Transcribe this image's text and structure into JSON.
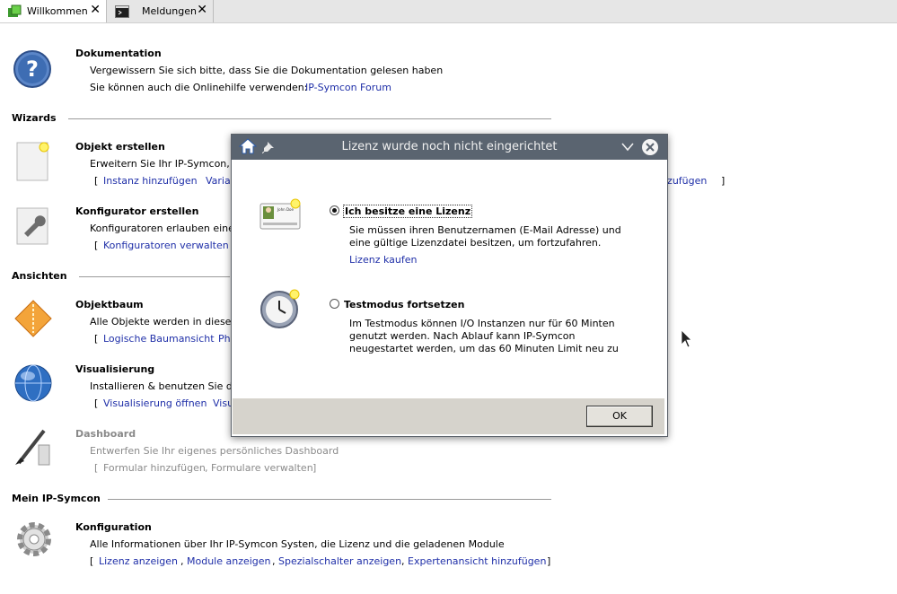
{
  "tabs": [
    {
      "label": "Willkommen",
      "active": true
    },
    {
      "label": "Meldungen",
      "active": false
    }
  ],
  "doc": {
    "title": "Dokumentation",
    "line1": "Vergewissern Sie sich bitte, dass Sie die Dokumentation gelesen haben",
    "line2": "Sie können auch die Onlinehilfe verwenden:",
    "forum_link": "IP-Symcon Forum"
  },
  "sections": {
    "wizards": "Wizards",
    "ansichten": "Ansichten",
    "mein": "Mein IP-Symcon"
  },
  "objekt": {
    "title": "Objekt erstellen",
    "desc": "Erweitern Sie Ihr IP-Symcon, ind",
    "link1": "Instanz hinzufügen",
    "link2": "Variab",
    "link_end": "ızufügen"
  },
  "konfigurator": {
    "title": "Konfigurator erstellen",
    "desc": "Konfiguratoren erlauben eine ein",
    "link1": "Konfiguratoren verwalten"
  },
  "objektbaum": {
    "title": "Objektbaum",
    "desc": "Alle Objekte werden in diesem Ba",
    "link1": "Logische Baumansicht",
    "link2": "Phy"
  },
  "visual": {
    "title": "Visualisierung",
    "desc": "Installieren & benutzen Sie das I",
    "link1": "Visualisierung öffnen",
    "link2": "Visu"
  },
  "dashboard": {
    "title": "Dashboard",
    "desc": "Entwerfen Sie Ihr eigenes persönliches Dashboard",
    "link1": "Formular hinzufügen",
    "link2": "Formulare verwalten"
  },
  "konfig": {
    "title": "Konfiguration",
    "desc": "Alle Informationen über Ihr IP-Symcon Systen, die Lizenz und die geladenen Module",
    "link1": "Lizenz anzeigen",
    "link2": "Module anzeigen",
    "link3": "Spezialschalter anzeigen",
    "link4": "Expertenansicht hinzufügen"
  },
  "brackets": {
    "open": "[",
    "close": "]",
    "sep": ","
  },
  "dialog": {
    "title": "Lizenz wurde noch nicht eingerichtet",
    "option1": {
      "label": "Ich besitze eine Lizenz",
      "text1": "Sie müssen ihren Benutzernamen (E-Mail Adresse) und",
      "text2": "eine gültige Lizenzdatei besitzen, um fortzufahren.",
      "link": "Lizenz kaufen",
      "card_name": "John Doe",
      "selected": true
    },
    "option2": {
      "label": "Testmodus fortsetzen",
      "text1": "Im Testmodus können I/O Instanzen nur für 60 Minten",
      "text2": "genutzt werden. Nach Ablauf kann IP-Symcon",
      "text3": "neugestartet werden, um das 60 Minuten Limit neu zu",
      "selected": false
    },
    "ok_label": "OK"
  },
  "colors": {
    "link": "#1f2fa8",
    "titlebar": "#5a6470",
    "footer": "#d6d3cc"
  }
}
